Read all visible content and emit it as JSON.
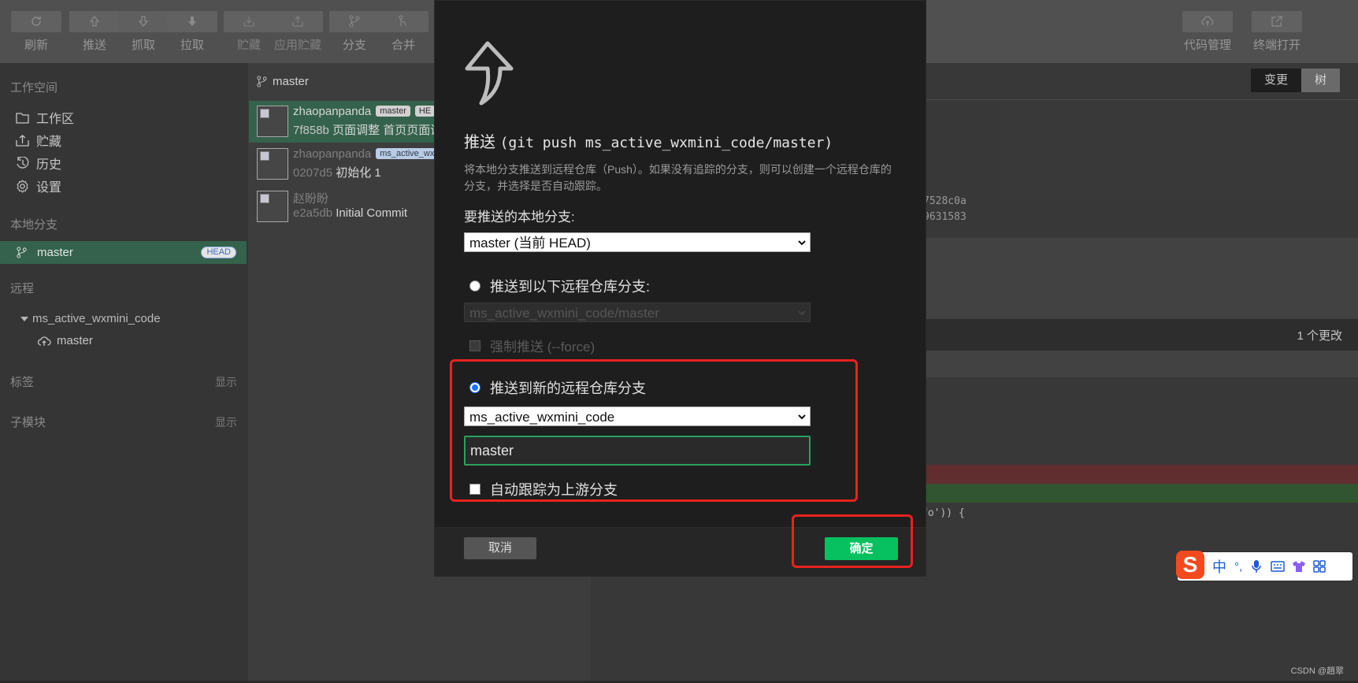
{
  "toolbar": {
    "refresh": "刷新",
    "push": "推送",
    "fetch": "抓取",
    "pull": "拉取",
    "stash": "贮藏",
    "apply_stash": "应用贮藏",
    "branch": "分支",
    "merge": "合并",
    "code_manage": "代码管理",
    "terminal": "终端打开"
  },
  "sidebar": {
    "workspace_title": "工作空间",
    "items": [
      {
        "label": "工作区",
        "icon": "folder-icon"
      },
      {
        "label": "贮藏",
        "icon": "stash-icon"
      },
      {
        "label": "历史",
        "icon": "history-icon"
      },
      {
        "label": "设置",
        "icon": "gear-icon"
      }
    ],
    "local_title": "本地分支",
    "local_branch": "master",
    "head_badge": "HEAD",
    "remote_title": "远程",
    "remote_name": "ms_active_wxmini_code",
    "remote_branch": "master",
    "tags_title": "标签",
    "tags_show": "显示",
    "submodules_title": "子模块",
    "submodules_show": "显示"
  },
  "commits": {
    "branch": "master",
    "list": [
      {
        "author": "zhaopanpanda",
        "tag1": "master",
        "tag2": "HE",
        "hash": "7f858b",
        "message": "页面调整 首页页面调"
      },
      {
        "author": "zhaopanpanda",
        "tag1": "ms_active_wx",
        "hash": "0207d5",
        "message": "初始化 1"
      },
      {
        "author": "赵盼盼",
        "hash": "e2a5db",
        "message": "Initial Commit"
      }
    ]
  },
  "right": {
    "seg_changes": "变更",
    "seg_tree": "树",
    "hash1": "7528c0a",
    "hash2": "9631583",
    "changes_count": "1 个更改",
    "code_fragment": "fo')) {"
  },
  "dialog": {
    "title_prefix": "推送",
    "title_code": "(git push ms_active_wxmini_code/master)",
    "description": "将本地分支推送到远程仓库（Push）。如果没有追踪的分支，则可以创建一个远程仓库的分支，并选择是否自动跟踪。",
    "local_branch_label": "要推送的本地分支:",
    "local_branch_value": "master (当前 HEAD)",
    "option_existing": "推送到以下远程仓库分支:",
    "existing_remote_value": "ms_active_wxmini_code/master",
    "force_label": "强制推送 (--force)",
    "option_new": "推送到新的远程仓库分支",
    "new_remote_value": "ms_active_wxmini_code",
    "new_branch_value": "master",
    "track_label": "自动跟踪为上游分支",
    "cancel": "取消",
    "confirm": "确定"
  },
  "ime": {
    "logo": "S",
    "lang": "中",
    "punct": "°,"
  },
  "watermark": "CSDN @趙翠",
  "colors": {
    "accent_green": "#07c160",
    "selection_green": "#3c6e55",
    "highlight_red": "#e8231f"
  }
}
